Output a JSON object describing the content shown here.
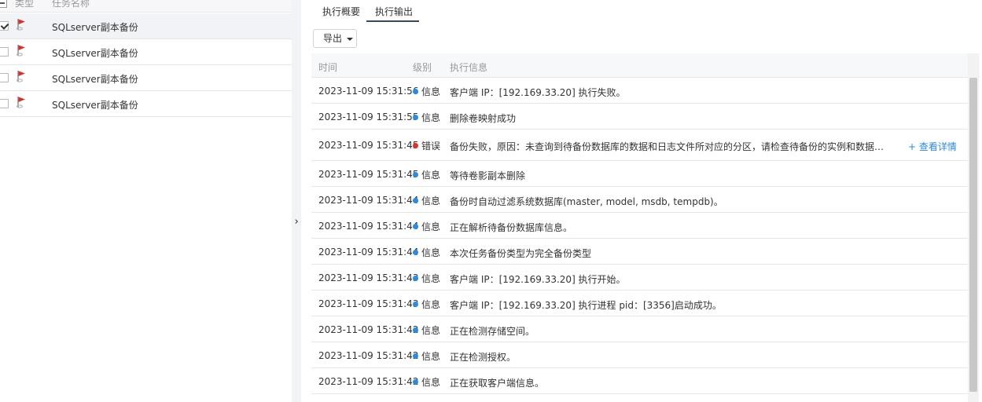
{
  "colors": {
    "info": "#2a8be6",
    "error": "#e0322a",
    "link": "#2a88e2",
    "tab_underline": "#3a4a5e"
  },
  "task_list": {
    "header": {
      "type_label": "类型",
      "name_label": "任务名称"
    },
    "rows": [
      {
        "name": "SQLserver副本备份",
        "checked": true,
        "icon": "red-flag-icon"
      },
      {
        "name": "SQLserver副本备份",
        "checked": false,
        "icon": "red-flag-icon"
      },
      {
        "name": "SQLserver副本备份",
        "checked": false,
        "icon": "red-flag-icon"
      },
      {
        "name": "SQLserver副本备份",
        "checked": false,
        "icon": "red-flag-icon"
      }
    ]
  },
  "splitter": {
    "arrow": "›"
  },
  "tabs": [
    {
      "label": "执行概要",
      "active": false
    },
    {
      "label": "执行输出",
      "active": true
    }
  ],
  "toolbar": {
    "export_label": "导出"
  },
  "log_table": {
    "columns": {
      "time": "时间",
      "level": "级别",
      "message": "执行信息"
    },
    "rows": [
      {
        "time": "2023-11-09 15:31:56",
        "level": "信息",
        "type": "info",
        "message": "客户端 IP：[192.169.33.20] 执行失败。"
      },
      {
        "time": "2023-11-09 15:31:55",
        "level": "信息",
        "type": "info",
        "message": "删除卷映射成功"
      },
      {
        "time": "2023-11-09 15:31:45",
        "level": "错误",
        "type": "error",
        "message": "备份失败，原因：未查询到待备份数据库的数据和日志文件所对应的分区，请检查待备份的实例和数据库是否处于…",
        "detail": "+ 查看详情"
      },
      {
        "time": "2023-11-09 15:31:45",
        "level": "信息",
        "type": "info",
        "message": "等待卷影副本删除"
      },
      {
        "time": "2023-11-09 15:31:44",
        "level": "信息",
        "type": "info",
        "message": "备份时自动过滤系统数据库(master, model, msdb, tempdb)。"
      },
      {
        "time": "2023-11-09 15:31:44",
        "level": "信息",
        "type": "info",
        "message": "正在解析待备份数据库信息。"
      },
      {
        "time": "2023-11-09 15:31:44",
        "level": "信息",
        "type": "info",
        "message": "本次任务备份类型为完全备份类型"
      },
      {
        "time": "2023-11-09 15:31:43",
        "level": "信息",
        "type": "info",
        "message": "客户端 IP：[192.169.33.20] 执行开始。"
      },
      {
        "time": "2023-11-09 15:31:43",
        "level": "信息",
        "type": "info",
        "message": "客户端 IP：[192.169.33.20] 执行进程 pid：[3356]启动成功。"
      },
      {
        "time": "2023-11-09 15:31:42",
        "level": "信息",
        "type": "info",
        "message": "正在检测存储空间。"
      },
      {
        "time": "2023-11-09 15:31:42",
        "level": "信息",
        "type": "info",
        "message": "正在检测授权。"
      },
      {
        "time": "2023-11-09 15:31:42",
        "level": "信息",
        "type": "info",
        "message": "正在获取客户端信息。"
      }
    ]
  }
}
